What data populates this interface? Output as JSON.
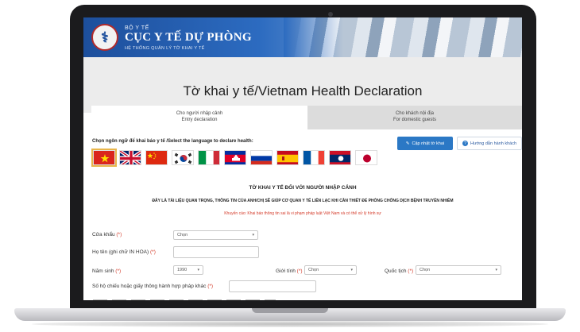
{
  "banner": {
    "ministry": "BỘ Y TẾ",
    "agency": "CỤC Y TẾ DỰ PHÒNG",
    "system": "HỆ THỐNG QUẢN LÝ TỜ KHAI Y TẾ"
  },
  "page_title": "Tờ khai y tế/Vietnam Health Declaration",
  "tabs": [
    {
      "line1": "Cho người nhập cảnh",
      "line2": "Entry declaration",
      "active": true
    },
    {
      "line1": "Cho khách nội địa",
      "line2": "For domestic guests",
      "active": false
    }
  ],
  "language": {
    "label": "Chọn ngôn ngữ để khai báo y tế /Select the language to declare health:",
    "flags": [
      {
        "icon": "vietnam-flag-icon",
        "selected": true
      },
      {
        "icon": "uk-flag-icon"
      },
      {
        "icon": "china-flag-icon"
      },
      {
        "icon": "korea-flag-icon"
      },
      {
        "icon": "italy-flag-icon"
      },
      {
        "icon": "cambodia-flag-icon"
      },
      {
        "icon": "russia-flag-icon"
      },
      {
        "icon": "spain-flag-icon"
      },
      {
        "icon": "france-flag-icon"
      },
      {
        "icon": "laos-flag-icon"
      },
      {
        "icon": "japan-flag-icon"
      }
    ]
  },
  "buttons": {
    "update": "Cập nhật tờ khai",
    "guide": "Hướng dẫn hành khách"
  },
  "form": {
    "title": "TỜ KHAI Y TẾ ĐỐI VỚI NGƯỜI NHẬP CẢNH",
    "description": "ĐÂY LÀ TÀI LIỆU QUAN TRỌNG, THÔNG TIN CỦA ANH/CHỊ SẼ GIÚP CƠ QUAN Y TẾ LIÊN LẠC KHI CẦN THIẾT ĐỂ PHÒNG CHỐNG DỊCH BỆNH TRUYỀN NHIỄM",
    "warning": "Khuyến cáo: Khai báo thông tin sai là vi phạm pháp luật Việt Nam và có thể xử lý hình sự",
    "border_gate_label": "Cửa khẩu",
    "border_gate_value": "Chọn",
    "name_label": "Họ tên (ghi chữ IN HOA)",
    "birth_year_label": "Năm sinh",
    "birth_year_value": "1990",
    "gender_label": "Giới tính",
    "gender_value": "Chọn",
    "nationality_label": "Quốc tịch",
    "nationality_value": "Chọn",
    "passport_label": "Số hộ chiếu hoặc giấy thông hành hợp pháp khác",
    "required_mark": "(*)"
  },
  "colors": {
    "primary": "#2b78c5",
    "banner": "#1d4f9c",
    "warning": "#d43b2a"
  }
}
